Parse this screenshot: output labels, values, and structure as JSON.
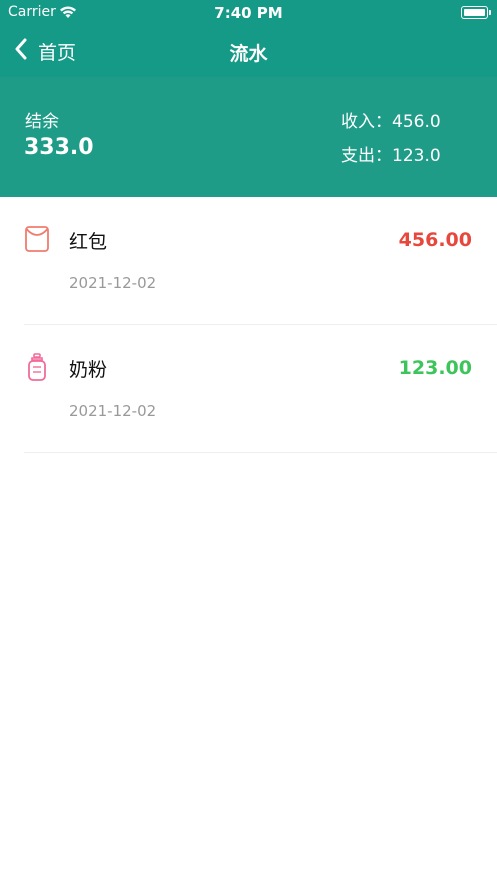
{
  "status_bar": {
    "carrier": "Carrier",
    "time": "7:40 PM"
  },
  "nav": {
    "back_label": "首页",
    "title": "流水"
  },
  "summary": {
    "balance_label": "结余",
    "balance_value": "333.0",
    "income_text": "收入：456.0",
    "expense_text": "支出：123.0"
  },
  "records": [
    {
      "icon": "red-envelope-icon",
      "name": "红包",
      "amount": "456.00",
      "date": "2021-12-02",
      "amount_color": "#e8473d"
    },
    {
      "icon": "baby-bottle-icon",
      "name": "奶粉",
      "amount": "123.00",
      "date": "2021-12-02",
      "amount_color": "#3dc45a"
    }
  ],
  "colors": {
    "header": "#169a88",
    "summary": "#1f9c88"
  }
}
